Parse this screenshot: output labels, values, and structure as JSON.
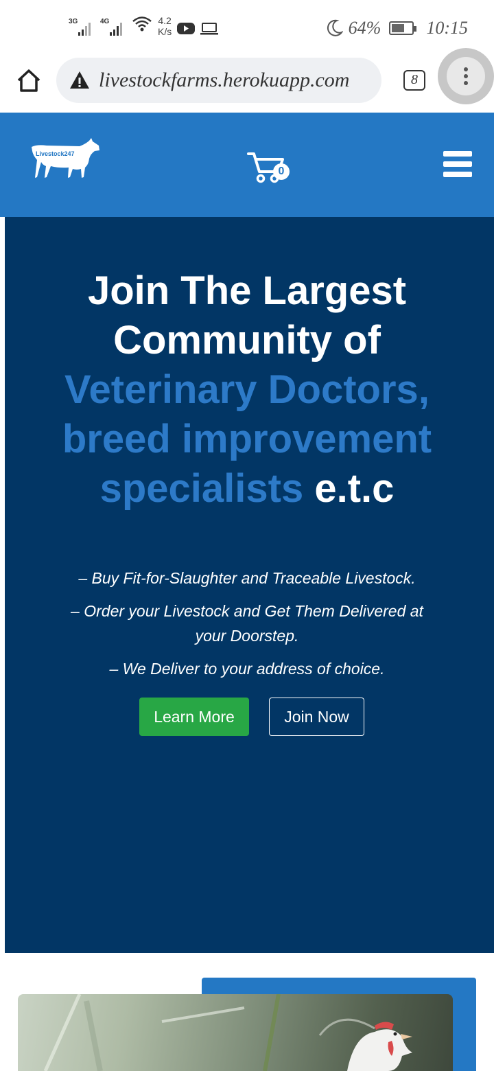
{
  "status_bar": {
    "network1": "3G",
    "network2": "4G",
    "speed_value": "4.2",
    "speed_unit": "K/s",
    "battery_percent": "64%",
    "battery_level": 0.64,
    "time": "10:15"
  },
  "browser": {
    "url": "livestockfarms.herokuapp.com",
    "tab_count": "8"
  },
  "header": {
    "logo_text": "Livestock247",
    "cart_count": "0"
  },
  "hero": {
    "title_line1": "Join The Largest",
    "title_line2": "Community of",
    "title_highlight1": "Veterinary Doctors,",
    "title_highlight2": "breed improvement",
    "title_highlight3": "specialists",
    "title_suffix": "e.t.c",
    "points": [
      "– Buy Fit-for-Slaughter and Traceable Livestock.",
      "– Order your Livestock and Get Them Delivered at your Doorstep.",
      "– We Deliver to your address of choice."
    ],
    "learn_more": "Learn More",
    "join_now": "Join Now"
  },
  "colors": {
    "header_blue": "#2478c4",
    "hero_navy": "#023665",
    "highlight_blue": "#2d7ac8",
    "button_green": "#28a745"
  }
}
